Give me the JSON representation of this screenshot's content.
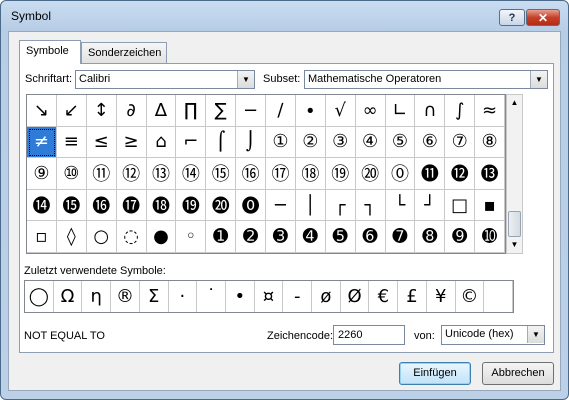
{
  "window": {
    "title": "Symbol",
    "help": "?",
    "close": "✕"
  },
  "tabs": [
    {
      "label": "Symbole"
    },
    {
      "label": "Sonderzeichen"
    }
  ],
  "font": {
    "label": "Schriftart:",
    "value": "Calibri"
  },
  "subset": {
    "label": "Subset:",
    "value": "Mathematische Operatoren"
  },
  "grid": [
    [
      "↘",
      "↙",
      "↕",
      "∂",
      "∆",
      "∏",
      "∑",
      "−",
      "∕",
      "∙",
      "√",
      "∞",
      "∟",
      "∩",
      "∫",
      "≈"
    ],
    [
      "≠",
      "≡",
      "≤",
      "≥",
      "⌂",
      "⌐",
      "⌠",
      "⌡",
      "①",
      "②",
      "③",
      "④",
      "⑤",
      "⑥",
      "⑦",
      "⑧"
    ],
    [
      "⑨",
      "⑩",
      "⑪",
      "⑫",
      "⑬",
      "⑭",
      "⑮",
      "⑯",
      "⑰",
      "⑱",
      "⑲",
      "⑳",
      "⓪",
      "⓫",
      "⓬",
      "⓭"
    ],
    [
      "⓮",
      "⓯",
      "⓰",
      "⓱",
      "⓲",
      "⓳",
      "⓴",
      "⓿",
      "─",
      "│",
      "┌",
      "┐",
      "└",
      "┘",
      "□",
      "▪"
    ],
    [
      "▫",
      "◊",
      "○",
      "◌",
      "●",
      "◦",
      "➊",
      "➋",
      "➌",
      "➍",
      "➎",
      "➏",
      "➐",
      "➑",
      "➒",
      "➓"
    ]
  ],
  "recent": {
    "label": "Zuletzt verwendete Symbole:",
    "symbols": [
      "◯",
      "Ω",
      "η",
      "®",
      "Σ",
      "·",
      "˙",
      "•",
      "¤",
      "-",
      "ø",
      "Ø",
      "€",
      "£",
      "¥",
      "©",
      ""
    ]
  },
  "char_name": "NOT EQUAL TO",
  "char_code": {
    "label": "Zeichencode:",
    "value": "2260"
  },
  "from": {
    "label": "von:",
    "value": "Unicode (hex)"
  },
  "buttons": {
    "insert": "Einfügen",
    "cancel": "Abbrechen"
  },
  "colors": {
    "selection": "#2f7bd8",
    "frame": "#bcd1e8"
  }
}
